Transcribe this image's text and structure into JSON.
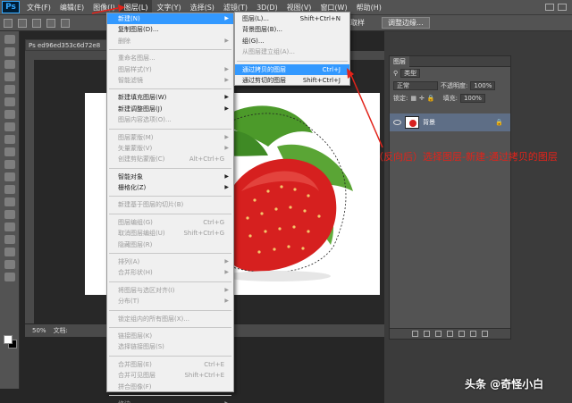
{
  "app": {
    "logo": "Ps"
  },
  "menubar": {
    "items": [
      "文件(F)",
      "编辑(E)",
      "图像(I)",
      "图层(L)",
      "文字(Y)",
      "选择(S)",
      "滤镜(T)",
      "3D(D)",
      "视图(V)",
      "窗口(W)",
      "帮助(H)"
    ],
    "active": "图层(L)"
  },
  "optbar": {
    "take_sample": "取样",
    "adjust_edge": "调整边缘..."
  },
  "document": {
    "tab": "ed96ed353c6d72e8",
    "zoom": "50%",
    "doc_info": "文档:"
  },
  "layer_menu": [
    {
      "label": "新建(N)",
      "arrow": true,
      "highlight": true
    },
    {
      "label": "复制图层(D)..."
    },
    {
      "label": "删除",
      "arrow": true,
      "disabled": true
    },
    {
      "sep": true
    },
    {
      "label": "重命名图层...",
      "disabled": true
    },
    {
      "label": "图层样式(Y)",
      "arrow": true,
      "disabled": true
    },
    {
      "label": "智能滤镜",
      "arrow": true,
      "disabled": true
    },
    {
      "sep": true
    },
    {
      "label": "新建填充图层(W)",
      "arrow": true
    },
    {
      "label": "新建调整图层(J)",
      "arrow": true
    },
    {
      "label": "图层内容选项(O)...",
      "disabled": true
    },
    {
      "sep": true
    },
    {
      "label": "图层蒙版(M)",
      "arrow": true,
      "disabled": true
    },
    {
      "label": "矢量蒙版(V)",
      "arrow": true,
      "disabled": true
    },
    {
      "label": "创建剪贴蒙版(C)",
      "shortcut": "Alt+Ctrl+G",
      "disabled": true
    },
    {
      "sep": true
    },
    {
      "label": "智能对象",
      "arrow": true
    },
    {
      "label": "栅格化(Z)",
      "arrow": true
    },
    {
      "sep": true
    },
    {
      "label": "新建基于图层的切片(B)",
      "disabled": true
    },
    {
      "sep": true
    },
    {
      "label": "图层编组(G)",
      "shortcut": "Ctrl+G",
      "disabled": true
    },
    {
      "label": "取消图层编组(U)",
      "shortcut": "Shift+Ctrl+G",
      "disabled": true
    },
    {
      "label": "隐藏图层(R)",
      "disabled": true
    },
    {
      "sep": true
    },
    {
      "label": "排列(A)",
      "arrow": true,
      "disabled": true
    },
    {
      "label": "合并形状(H)",
      "arrow": true,
      "disabled": true
    },
    {
      "sep": true
    },
    {
      "label": "将图层与选区对齐(I)",
      "arrow": true,
      "disabled": true
    },
    {
      "label": "分布(T)",
      "arrow": true,
      "disabled": true
    },
    {
      "sep": true
    },
    {
      "label": "锁定组内的所有图层(X)...",
      "disabled": true
    },
    {
      "sep": true
    },
    {
      "label": "链接图层(K)",
      "disabled": true
    },
    {
      "label": "选择链接图层(S)",
      "disabled": true
    },
    {
      "sep": true
    },
    {
      "label": "合并图层(E)",
      "shortcut": "Ctrl+E",
      "disabled": true
    },
    {
      "label": "合并可见图层",
      "shortcut": "Shift+Ctrl+E",
      "disabled": true
    },
    {
      "label": "拼合图像(F)",
      "disabled": true
    },
    {
      "sep": true
    },
    {
      "label": "修边",
      "arrow": true,
      "disabled": true
    }
  ],
  "new_submenu": [
    {
      "label": "图层(L)...",
      "shortcut": "Shift+Ctrl+N"
    },
    {
      "label": "背景图层(B)..."
    },
    {
      "label": "组(G)..."
    },
    {
      "label": "从图层建立组(A)...",
      "disabled": true
    },
    {
      "sep": true
    },
    {
      "label": "通过拷贝的图层",
      "shortcut": "Ctrl+J",
      "highlight": true
    },
    {
      "label": "通过剪切的图层",
      "shortcut": "Shift+Ctrl+J"
    }
  ],
  "layers_panel": {
    "tab": "图层",
    "kind": "类型",
    "blend_mode": "正常",
    "opacity_label": "不透明度:",
    "opacity": "100%",
    "lock_label": "锁定:",
    "fill_label": "填充:",
    "fill": "100%",
    "layer_name": "背景"
  },
  "annotation": "（反向后）选择图层-新建-通过拷贝的图层",
  "watermark": "头条 @奇怪小白",
  "colors": {
    "highlight": "#3399ff",
    "annotation": "#e2231a",
    "strawberry": "#d6201f",
    "leaf": "#4c9a2a"
  }
}
